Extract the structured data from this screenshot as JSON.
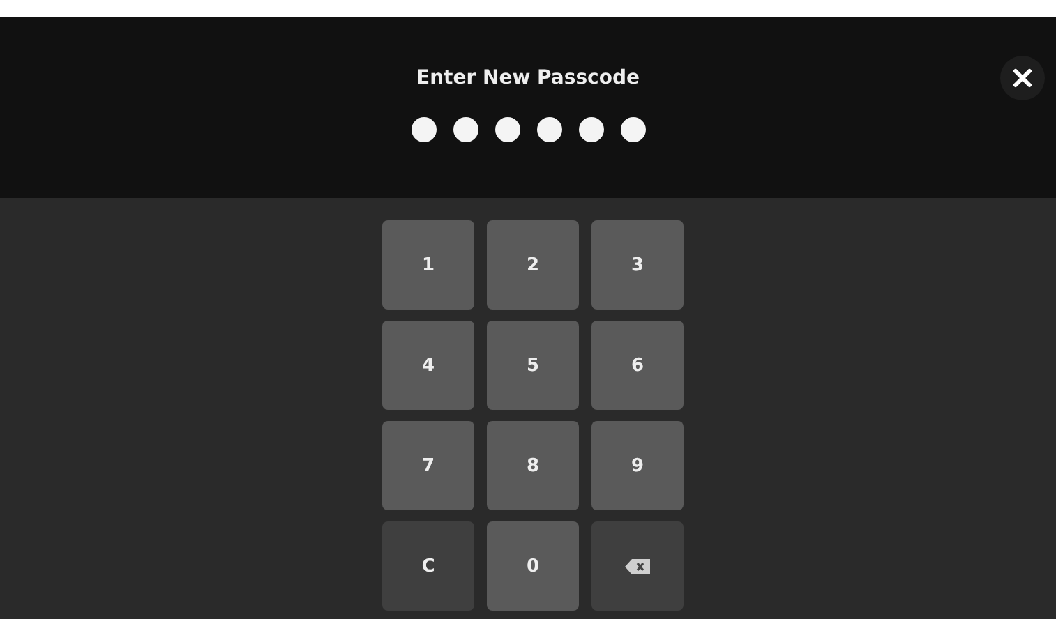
{
  "header": {
    "title": "Enter New Passcode",
    "dots": [
      {
        "filled": true
      },
      {
        "filled": true
      },
      {
        "filled": true
      },
      {
        "filled": true
      },
      {
        "filled": true
      },
      {
        "filled": true
      }
    ]
  },
  "keys": [
    {
      "kind": "digit",
      "label": "1"
    },
    {
      "kind": "digit",
      "label": "2"
    },
    {
      "kind": "digit",
      "label": "3"
    },
    {
      "kind": "digit",
      "label": "4"
    },
    {
      "kind": "digit",
      "label": "5"
    },
    {
      "kind": "digit",
      "label": "6"
    },
    {
      "kind": "digit",
      "label": "7"
    },
    {
      "kind": "digit",
      "label": "8"
    },
    {
      "kind": "digit",
      "label": "9"
    },
    {
      "kind": "clear",
      "label": "C"
    },
    {
      "kind": "digit",
      "label": "0"
    },
    {
      "kind": "backspace"
    }
  ]
}
